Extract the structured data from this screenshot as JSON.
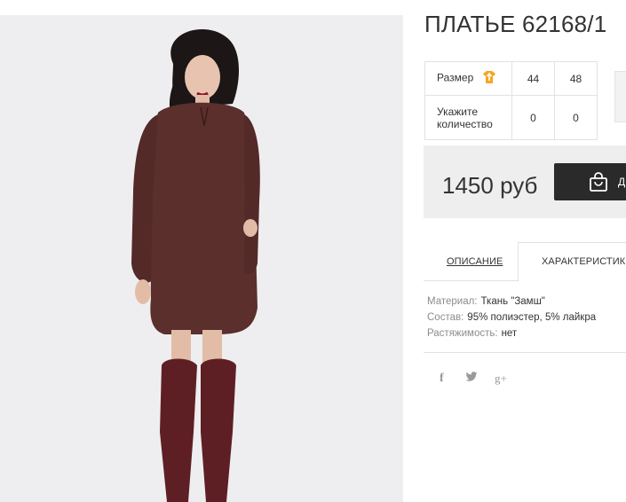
{
  "product": {
    "title": "ПЛАТЬЕ 62168/1",
    "image_alt": "photo of a woman in a brown suede dress and burgundy over-the-knee boots"
  },
  "sizes": {
    "size_label": "Размер",
    "size_icon": "shirt-icon",
    "qty_label_line1": "Укажите",
    "qty_label_line2": "количество",
    "options": [
      {
        "size": "44",
        "qty": "0"
      },
      {
        "size": "48",
        "qty": "0"
      }
    ]
  },
  "price": {
    "value": "1450 руб",
    "buy_label": "Д"
  },
  "tabs": [
    {
      "label": "ОПИСАНИЕ",
      "active": false
    },
    {
      "label": "ХАРАКТЕРИСТИКИ",
      "active": true
    }
  ],
  "specs": [
    {
      "key": "Материал:",
      "value": "Ткань \"Замш\""
    },
    {
      "key": "Состав:",
      "value": "95% полиэстер, 5% лайкра"
    },
    {
      "key": "Растяжимость:",
      "value": "нет"
    }
  ],
  "social": {
    "facebook": "f",
    "twitter": "twitter-icon",
    "gplus": "g+"
  },
  "colors": {
    "dress": "#5a2f2c",
    "boots": "#5e1f24",
    "dark_button": "#2a2a2a",
    "size_icon": "#f5a623"
  }
}
